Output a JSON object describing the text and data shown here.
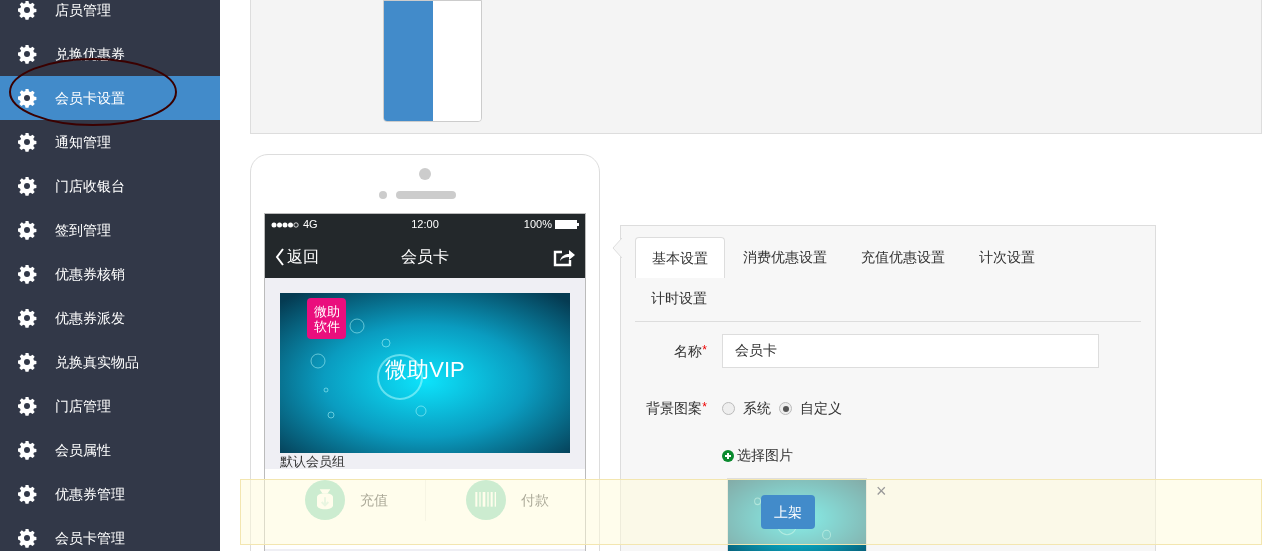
{
  "sidebar": {
    "items": [
      {
        "label": "店员管理",
        "selected": false
      },
      {
        "label": "兑换优惠券",
        "selected": false
      },
      {
        "label": "会员卡设置",
        "selected": true
      },
      {
        "label": "通知管理",
        "selected": false
      },
      {
        "label": "门店收银台",
        "selected": false
      },
      {
        "label": "签到管理",
        "selected": false
      },
      {
        "label": "优惠券核销",
        "selected": false
      },
      {
        "label": "优惠券派发",
        "selected": false
      },
      {
        "label": "兑换真实物品",
        "selected": false
      },
      {
        "label": "门店管理",
        "selected": false
      },
      {
        "label": "会员属性",
        "selected": false
      },
      {
        "label": "优惠券管理",
        "selected": false
      },
      {
        "label": "会员卡管理",
        "selected": false
      }
    ]
  },
  "phone": {
    "status": {
      "network": "4G",
      "time": "12:00",
      "battery": "100%"
    },
    "nav": {
      "back": "返回",
      "title": "会员卡"
    },
    "card": {
      "badge": "微助软件",
      "title": "微助VIP",
      "group": "默认会员组"
    },
    "actions": [
      {
        "label": "充值",
        "kind": "deposit"
      },
      {
        "label": "付款",
        "kind": "pay"
      }
    ]
  },
  "panel": {
    "tabs": [
      {
        "label": "基本设置",
        "selected": true
      },
      {
        "label": "消费优惠设置",
        "selected": false
      },
      {
        "label": "充值优惠设置",
        "selected": false
      },
      {
        "label": "计次设置",
        "selected": false
      },
      {
        "label": "计时设置",
        "selected": false
      }
    ],
    "name_field": {
      "label": "名称",
      "required_mark": "*",
      "value": "会员卡"
    },
    "background_field": {
      "label": "背景图案",
      "required_mark": "*",
      "options": [
        {
          "label": "系统",
          "selected": false
        },
        {
          "label": "自定义",
          "selected": true
        }
      ],
      "choose_image": "选择图片"
    }
  },
  "action_bar": {
    "button": "上架",
    "close": "×"
  }
}
